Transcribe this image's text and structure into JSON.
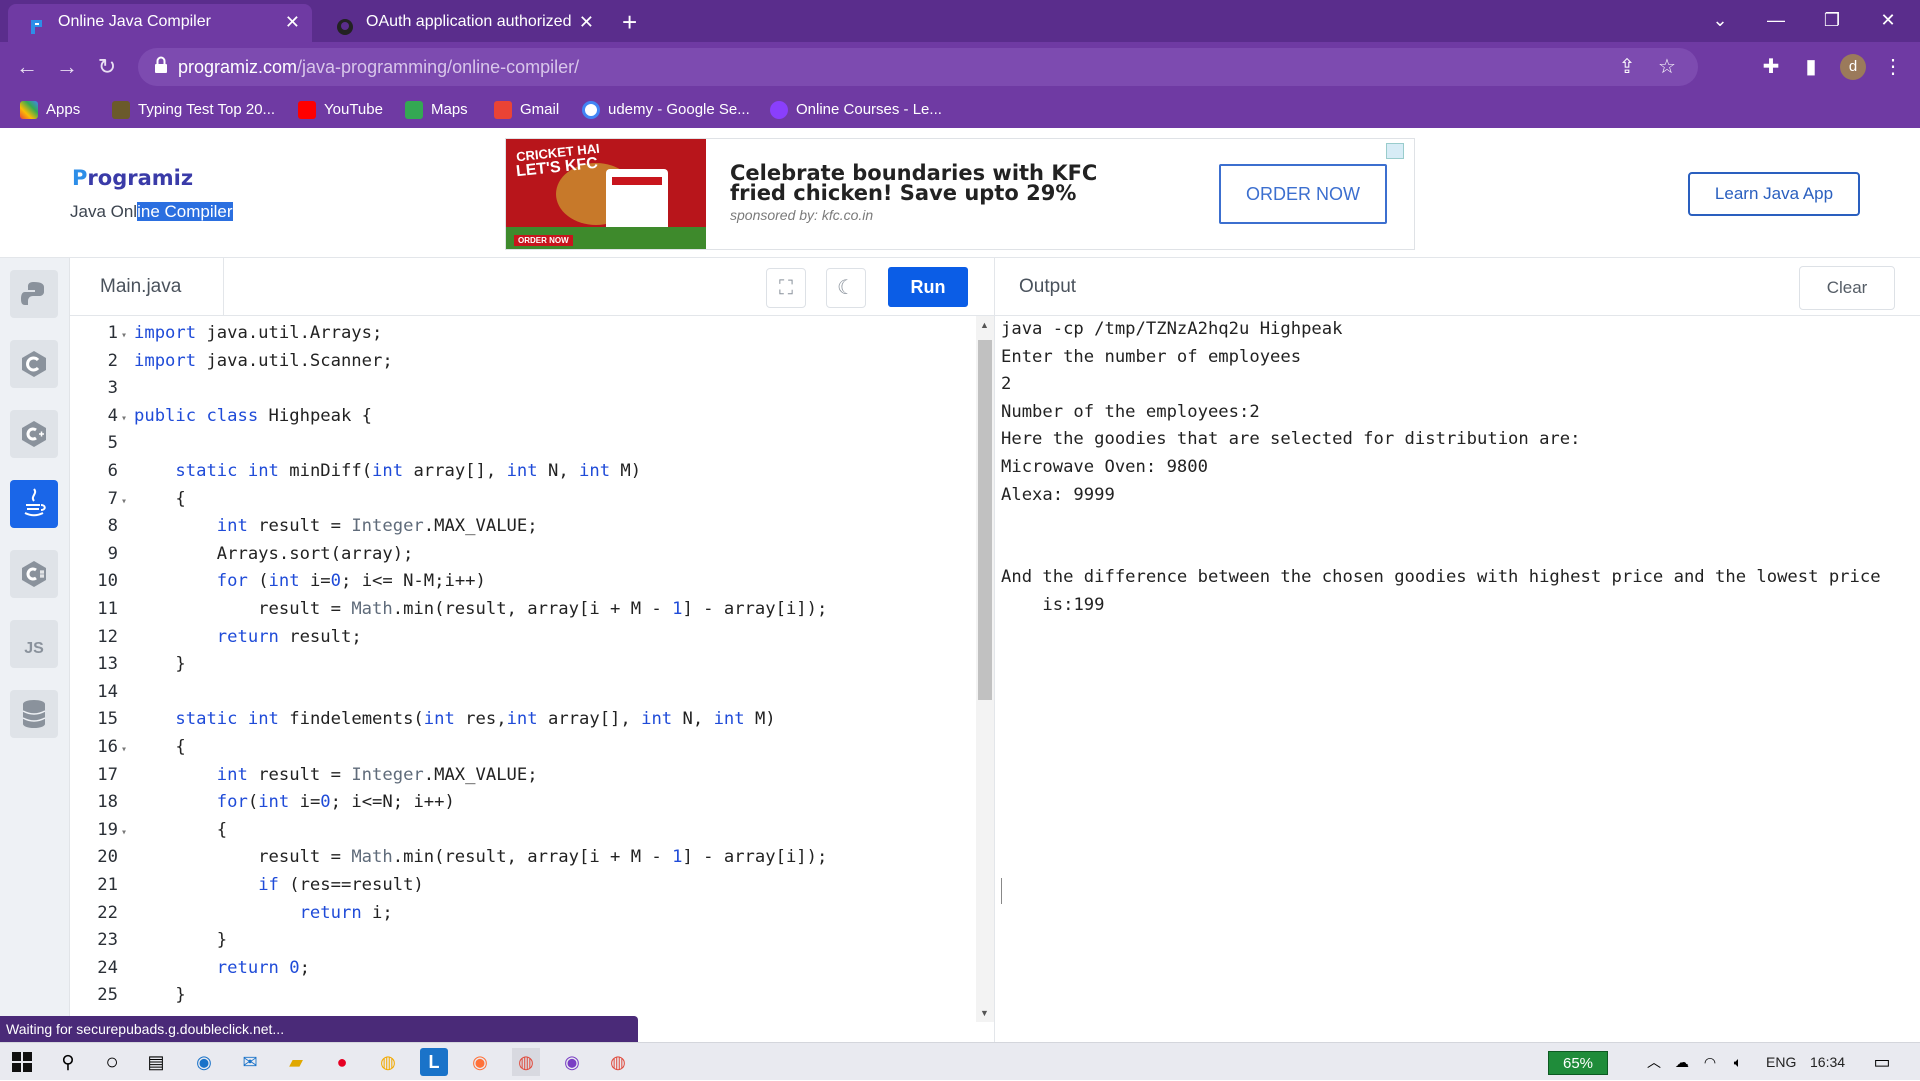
{
  "browser": {
    "tabs": [
      {
        "title": "Online Java Compiler",
        "active": true
      },
      {
        "title": "OAuth application authorized",
        "active": false
      }
    ],
    "new_tab_icon": "plus-icon",
    "url_host": "programiz.com",
    "url_path": "/java-programming/online-compiler/",
    "profile_initial": "d",
    "bookmarks": [
      {
        "label": "Apps",
        "color": "#4285f4"
      },
      {
        "label": "Typing Test Top 20...",
        "color": "#6b5a2b"
      },
      {
        "label": "YouTube",
        "color": "#ff0000"
      },
      {
        "label": "Maps",
        "color": "#34a853"
      },
      {
        "label": "Gmail",
        "color": "#ea4335"
      },
      {
        "label": "udemy - Google Se...",
        "color": "#4285f4"
      },
      {
        "label": "Online Courses - Le...",
        "color": "#8a3ffc"
      }
    ]
  },
  "site": {
    "logo": "rogramiz",
    "logo_initial": "P",
    "subtitle_plain": "Java Onl",
    "subtitle_selected": "ine Compiler",
    "learn_button": "Learn Java App"
  },
  "ad": {
    "image_line1": "CRICKET HAI",
    "image_line2": "LET'S KFC",
    "image_order": "ORDER NOW",
    "title": "Celebrate boundaries with KFC fried chicken! Save upto 29%",
    "sponsor": "sponsored by: kfc.co.in",
    "cta": "ORDER NOW"
  },
  "rail": [
    {
      "name": "python",
      "glyph": "⬢",
      "active": false
    },
    {
      "name": "c",
      "glyph": "C",
      "active": false
    },
    {
      "name": "cpp",
      "glyph": "C",
      "active": false
    },
    {
      "name": "java",
      "glyph": "☕",
      "active": true
    },
    {
      "name": "csharp",
      "glyph": "C",
      "active": false
    },
    {
      "name": "js",
      "glyph": "JS",
      "active": false
    },
    {
      "name": "sql",
      "glyph": "⛁",
      "active": false
    }
  ],
  "editor": {
    "file_tab": "Main.java",
    "run_label": "Run",
    "lines": [
      {
        "n": "1",
        "fold": true,
        "code": "import java.util.Arrays;"
      },
      {
        "n": "2",
        "fold": false,
        "code": "import java.util.Scanner;"
      },
      {
        "n": "3",
        "fold": false,
        "code": ""
      },
      {
        "n": "4",
        "fold": true,
        "code": "public class Highpeak {"
      },
      {
        "n": "5",
        "fold": false,
        "code": ""
      },
      {
        "n": "6",
        "fold": false,
        "code": "    static int minDiff(int array[], int N, int M)"
      },
      {
        "n": "7",
        "fold": true,
        "code": "    {"
      },
      {
        "n": "8",
        "fold": false,
        "code": "        int result = Integer.MAX_VALUE;"
      },
      {
        "n": "9",
        "fold": false,
        "code": "        Arrays.sort(array);"
      },
      {
        "n": "10",
        "fold": false,
        "code": "        for (int i=0; i<= N-M;i++)"
      },
      {
        "n": "11",
        "fold": false,
        "code": "            result = Math.min(result, array[i + M - 1] - array[i]);"
      },
      {
        "n": "12",
        "fold": false,
        "code": "        return result;"
      },
      {
        "n": "13",
        "fold": false,
        "code": "    }"
      },
      {
        "n": "14",
        "fold": false,
        "code": ""
      },
      {
        "n": "15",
        "fold": false,
        "code": "    static int findelements(int res,int array[], int N, int M)"
      },
      {
        "n": "16",
        "fold": true,
        "code": "    {"
      },
      {
        "n": "17",
        "fold": false,
        "code": "        int result = Integer.MAX_VALUE;"
      },
      {
        "n": "18",
        "fold": false,
        "code": "        for(int i=0; i<=N; i++)"
      },
      {
        "n": "19",
        "fold": true,
        "code": "        {"
      },
      {
        "n": "20",
        "fold": false,
        "code": "            result = Math.min(result, array[i + M - 1] - array[i]);"
      },
      {
        "n": "21",
        "fold": false,
        "code": "            if (res==result)"
      },
      {
        "n": "22",
        "fold": false,
        "code": "                return i;"
      },
      {
        "n": "23",
        "fold": false,
        "code": "        }"
      },
      {
        "n": "24",
        "fold": false,
        "code": "        return 0;"
      },
      {
        "n": "25",
        "fold": false,
        "code": "    }"
      }
    ]
  },
  "output": {
    "title": "Output",
    "clear_label": "Clear",
    "lines": [
      "java -cp /tmp/TZNzA2hq2u Highpeak",
      "Enter the number of employees",
      "2",
      "Number of the employees:2",
      "Here the goodies that are selected for distribution are:",
      "Microwave Oven: 9800",
      "Alexa: 9999",
      "",
      "",
      "And the difference between the chosen goodies with highest price and the lowest price",
      "    is:199"
    ]
  },
  "status_text": "Waiting for securepubads.g.doubleclick.net...",
  "taskbar": {
    "battery": "65%",
    "language": "ENG",
    "time": "16:34"
  }
}
